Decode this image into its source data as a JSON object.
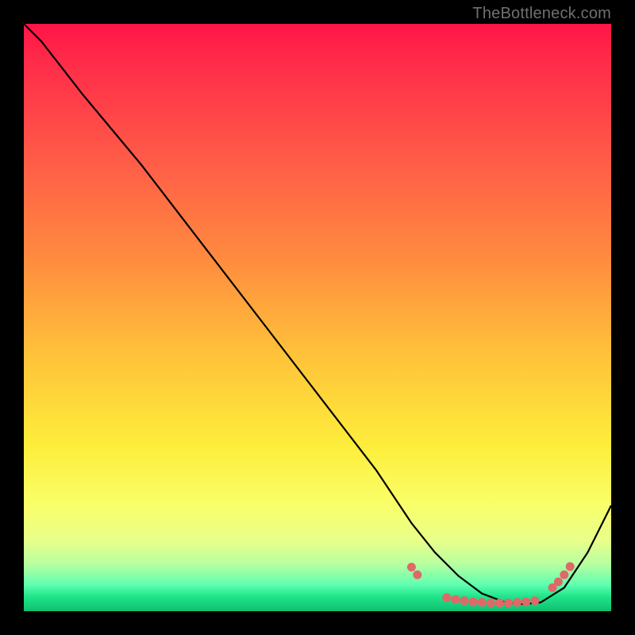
{
  "attribution": "TheBottleneck.com",
  "colors": {
    "background": "#000000",
    "curve_stroke": "#000000",
    "marker_fill": "#e06868",
    "text": "#707070"
  },
  "chart_data": {
    "type": "line",
    "title": "",
    "xlabel": "",
    "ylabel": "",
    "xlim": [
      0,
      100
    ],
    "ylim": [
      0,
      100
    ],
    "series": [
      {
        "name": "bottleneck-curve",
        "x": [
          0,
          3,
          10,
          20,
          30,
          40,
          50,
          60,
          66,
          70,
          74,
          78,
          82,
          85,
          88,
          92,
          96,
          100
        ],
        "y": [
          100,
          97,
          88,
          76,
          63,
          50,
          37,
          24,
          15,
          10,
          6,
          3,
          1.5,
          1.2,
          1.5,
          4,
          10,
          18
        ]
      }
    ],
    "markers": [
      {
        "x": 66,
        "y": 7.5
      },
      {
        "x": 67,
        "y": 6.2
      },
      {
        "x": 72,
        "y": 2.3
      },
      {
        "x": 73.5,
        "y": 2.0
      },
      {
        "x": 75,
        "y": 1.8
      },
      {
        "x": 76.5,
        "y": 1.6
      },
      {
        "x": 78,
        "y": 1.5
      },
      {
        "x": 79.5,
        "y": 1.4
      },
      {
        "x": 81,
        "y": 1.4
      },
      {
        "x": 82.5,
        "y": 1.4
      },
      {
        "x": 84,
        "y": 1.5
      },
      {
        "x": 85.5,
        "y": 1.6
      },
      {
        "x": 87,
        "y": 1.8
      },
      {
        "x": 90,
        "y": 4.0
      },
      {
        "x": 91,
        "y": 5.0
      },
      {
        "x": 92,
        "y": 6.2
      },
      {
        "x": 93,
        "y": 7.6
      }
    ]
  }
}
